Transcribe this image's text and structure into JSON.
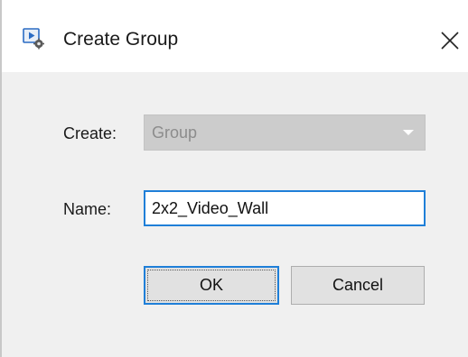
{
  "window": {
    "title": "Create Group",
    "icon": "group-app-icon",
    "close_icon": "close-icon"
  },
  "form": {
    "create_label": "Create:",
    "create_value": "Group",
    "name_label": "Name:",
    "name_value": "2x2_Video_Wall"
  },
  "buttons": {
    "ok_label": "OK",
    "cancel_label": "Cancel"
  },
  "colors": {
    "focus_accent": "#1f7fd8",
    "dialog_background": "#f0f0f0",
    "disabled_combo": "#cccccc"
  }
}
